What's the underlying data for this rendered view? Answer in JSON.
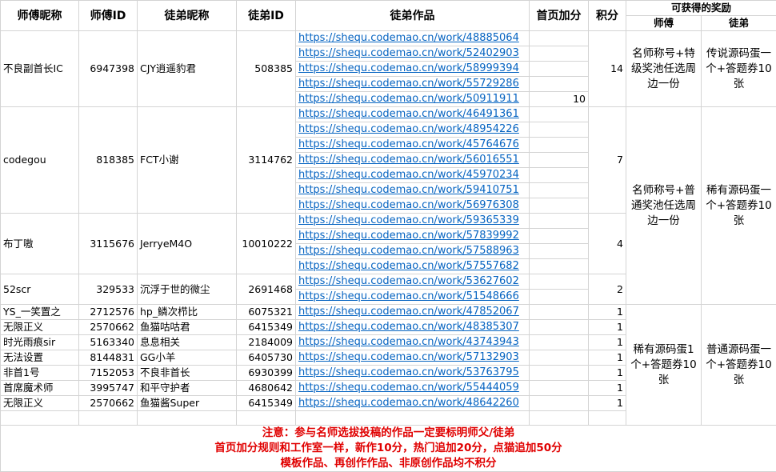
{
  "headers": {
    "master_name": "师傅昵称",
    "master_id": "师傅ID",
    "apprentice_name": "徒弟昵称",
    "apprentice_id": "徒弟ID",
    "works": "徒弟作品",
    "bonus": "首页加分",
    "score": "积分",
    "rewards": "可获得的奖励",
    "reward_master": "师傅",
    "reward_apprentice": "徒弟"
  },
  "groups": [
    {
      "master_name": "不良副首长IC",
      "master_id": "6947398",
      "apprentice_name": "CJY逍遥豹君",
      "apprentice_id": "508385",
      "works": [
        {
          "url": "https://shequ.codemao.cn/work/48885064",
          "bonus": ""
        },
        {
          "url": "https://shequ.codemao.cn/work/52402903",
          "bonus": ""
        },
        {
          "url": "https://shequ.codemao.cn/work/58999394",
          "bonus": ""
        },
        {
          "url": "https://shequ.codemao.cn/work/55729286",
          "bonus": ""
        },
        {
          "url": "https://shequ.codemao.cn/work/50911911",
          "bonus": "10"
        }
      ],
      "score": "14"
    },
    {
      "master_name": "codegou",
      "master_id": "818385",
      "apprentice_name": "FCT小谢",
      "apprentice_id": "3114762",
      "works": [
        {
          "url": "https://shequ.codemao.cn/work/46491361",
          "bonus": ""
        },
        {
          "url": "https://shequ.codemao.cn/work/48954226",
          "bonus": ""
        },
        {
          "url": "https://shequ.codemao.cn/work/45764676",
          "bonus": ""
        },
        {
          "url": "https://shequ.codemao.cn/work/56016551",
          "bonus": ""
        },
        {
          "url": "https://shequ.codemao.cn/work/45970234",
          "bonus": ""
        },
        {
          "url": "https://shequ.codemao.cn/work/59410751",
          "bonus": ""
        },
        {
          "url": "https://shequ.codemao.cn/work/56976308",
          "bonus": ""
        }
      ],
      "score": "7"
    },
    {
      "master_name": "布丁嗷",
      "master_id": "3115676",
      "apprentice_name": "JerryeM4O",
      "apprentice_id": "10010222",
      "works": [
        {
          "url": "https://shequ.codemao.cn/work/59365339",
          "bonus": ""
        },
        {
          "url": "https://shequ.codemao.cn/work/57839992",
          "bonus": ""
        },
        {
          "url": "https://shequ.codemao.cn/work/57588963",
          "bonus": ""
        },
        {
          "url": "https://shequ.codemao.cn/work/57557682",
          "bonus": ""
        }
      ],
      "score": "4"
    },
    {
      "master_name": "52scr",
      "master_id": "329533",
      "apprentice_name": "沉浮于世的微尘",
      "apprentice_id": "2691468",
      "works": [
        {
          "url": "https://shequ.codemao.cn/work/53627602",
          "bonus": ""
        },
        {
          "url": "https://shequ.codemao.cn/work/51548666",
          "bonus": ""
        }
      ],
      "score": "2"
    }
  ],
  "singles": [
    {
      "master_name": "YS_一笑置之",
      "master_id": "2712576",
      "apprentice_name": "hp_鳞次栉比",
      "apprentice_id": "6075321",
      "url": "https://shequ.codemao.cn/work/47852067",
      "score": "1"
    },
    {
      "master_name": "无限正义",
      "master_id": "2570662",
      "apprentice_name": "鱼猫咕咕君",
      "apprentice_id": "6415349",
      "url": "https://shequ.codemao.cn/work/48385307",
      "score": "1"
    },
    {
      "master_name": "时光雨痕sir",
      "master_id": "5163340",
      "apprentice_name": "息息相关",
      "apprentice_id": "2184009",
      "url": "https://shequ.codemao.cn/work/43743943",
      "score": "1"
    },
    {
      "master_name": "无法设置",
      "master_id": "8144831",
      "apprentice_name": "GG小羊",
      "apprentice_id": "6405730",
      "url": "https://shequ.codemao.cn/work/57132903",
      "score": "1"
    },
    {
      "master_name": "非首1号",
      "master_id": "7152053",
      "apprentice_name": "不良非首长",
      "apprentice_id": "6930399",
      "url": "https://shequ.codemao.cn/work/53763795",
      "score": "1"
    },
    {
      "master_name": "首席魔术师",
      "master_id": "3995747",
      "apprentice_name": "和平守护者",
      "apprentice_id": "4680642",
      "url": "https://shequ.codemao.cn/work/55444059",
      "score": "1"
    },
    {
      "master_name": "无限正义",
      "master_id": "2570662",
      "apprentice_name": "鱼猫酱Super",
      "apprentice_id": "6415349",
      "url": "https://shequ.codemao.cn/work/48642260",
      "score": "1"
    }
  ],
  "rewards": {
    "tier1_master": "名师称号+特级奖池任选周边一份",
    "tier1_apprentice": "传说源码蛋一个+答题券10张",
    "tier2_master": "名师称号+普通奖池任选周边一份",
    "tier2_apprentice": "稀有源码蛋一个+答题券10张",
    "tier3_master": "稀有源码蛋1个+答题券10张",
    "tier3_apprentice": "普通源码蛋一个+答题券10张"
  },
  "notes": {
    "line1": "注意：参与名师选拔投稿的作品一定要标明师父/徒弟",
    "line2": "首页加分规则和工作室一样，新作10分，热门追加20分，点猫追加50分",
    "line3": "模板作品、再创作作品、非原创作品均不积分"
  }
}
